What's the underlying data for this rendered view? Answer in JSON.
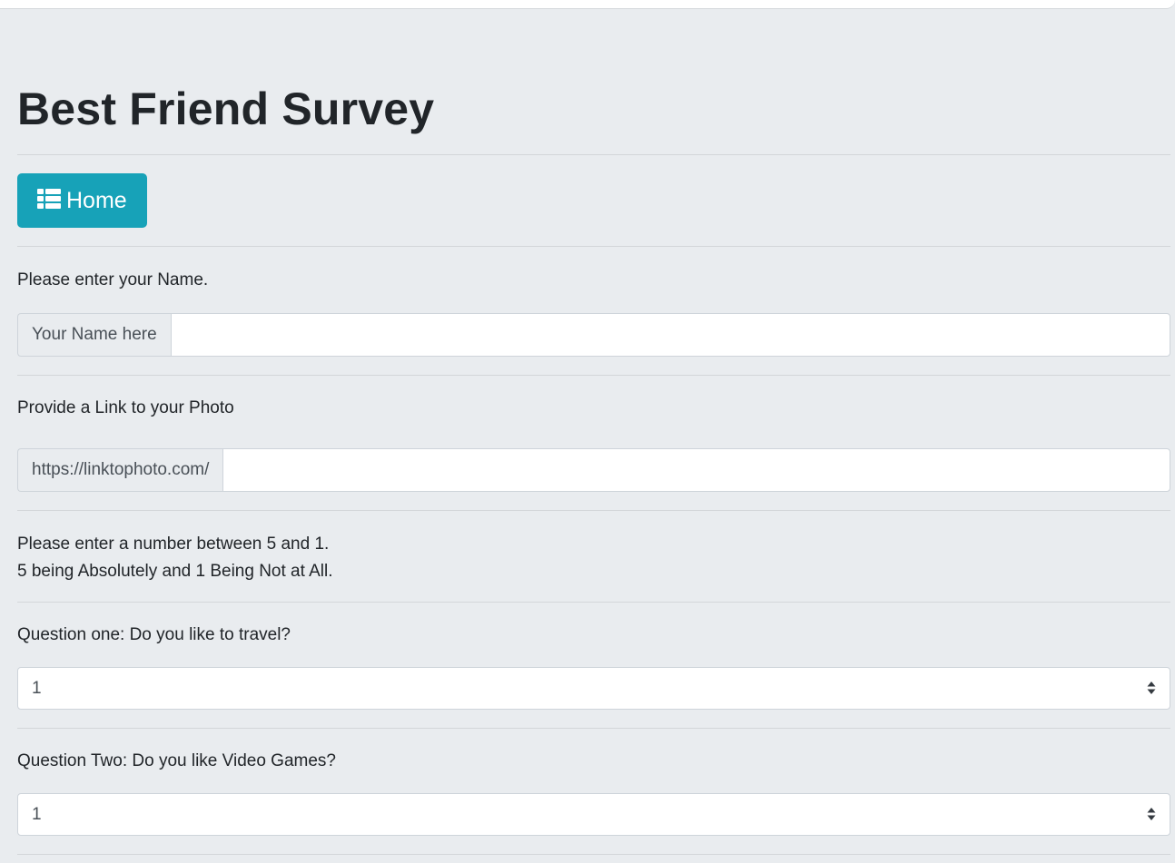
{
  "page": {
    "title": "Best Friend Survey",
    "accent_color": "#17a2b8"
  },
  "home_button": {
    "label": "Home",
    "icon": "list-icon"
  },
  "name_section": {
    "label": "Please enter your Name.",
    "addon": "Your Name here",
    "value": ""
  },
  "photo_section": {
    "label": "Provide a Link to your Photo",
    "addon": "https://linktophoto.com/",
    "value": ""
  },
  "instructions": {
    "line1": "Please enter a number between 5 and 1.",
    "line2": "5 being Absolutely and 1 Being Not at All."
  },
  "questions": [
    {
      "label": "Question one: Do you like to travel?",
      "selected": "1"
    },
    {
      "label": "Question Two: Do you like Video Games?",
      "selected": "1"
    }
  ]
}
